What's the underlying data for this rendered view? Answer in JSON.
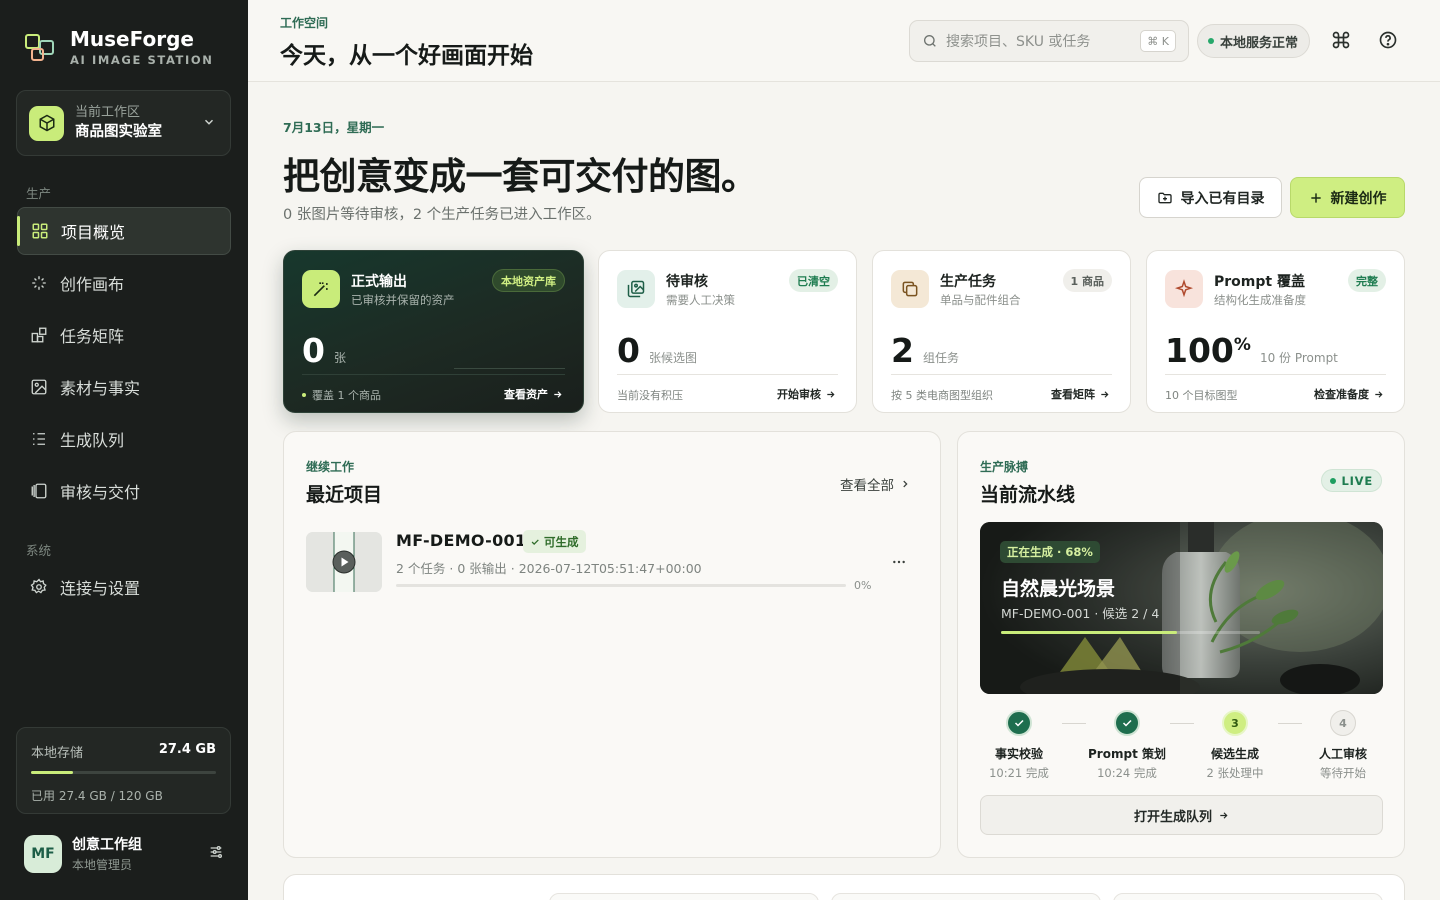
{
  "sidebar": {
    "brand": {
      "name": "MuseForge",
      "subtitle": "AI IMAGE STATION"
    },
    "workspace": {
      "label": "当前工作区",
      "name": "商品图实验室"
    },
    "sections": [
      {
        "title": "生产",
        "items": [
          {
            "label": "项目概览",
            "icon": "grid-icon",
            "active": true
          },
          {
            "label": "创作画布",
            "icon": "sparkle-icon"
          },
          {
            "label": "任务矩阵",
            "icon": "matrix-icon"
          },
          {
            "label": "素材与事实",
            "icon": "image-icon"
          },
          {
            "label": "生成队列",
            "icon": "list-icon"
          },
          {
            "label": "审核与交付",
            "icon": "review-icon"
          }
        ]
      },
      {
        "title": "系统",
        "items": [
          {
            "label": "连接与设置",
            "icon": "gear-icon"
          }
        ]
      }
    ],
    "storage": {
      "label": "本地存储",
      "value": "27.4 GB",
      "detail": "已用 27.4 GB / 120 GB",
      "used_fraction": 0.228
    },
    "user": {
      "initials": "MF",
      "name": "创意工作组",
      "role": "本地管理员"
    }
  },
  "header": {
    "eyebrow": "工作空间",
    "title": "今天，从一个好画面开始",
    "search_placeholder": "搜索项目、SKU 或任务",
    "shortcut": "⌘ K",
    "status": "本地服务正常"
  },
  "hero": {
    "date": "7月13日，星期一",
    "title": "把创意变成一套可交付的图。",
    "subtitle": "0 张图片等待审核，2 个生产任务已进入工作区。",
    "import_label": "导入已有目录",
    "new_label": "新建创作"
  },
  "stats": [
    {
      "title": "正式输出",
      "subtitle": "已审核并保留的资产",
      "badge": "本地资产库",
      "value": "0",
      "unit": "张",
      "footer": "覆盖 1 个商品",
      "link": "查看资产"
    },
    {
      "title": "待审核",
      "subtitle": "需要人工决策",
      "badge": "已清空",
      "value": "0",
      "unit": "张候选图",
      "footer": "当前没有积压",
      "link": "开始审核"
    },
    {
      "title": "生产任务",
      "subtitle": "单品与配件组合",
      "badge": "1 商品",
      "value": "2",
      "unit": "组任务",
      "footer": "按 5 类电商图型组织",
      "link": "查看矩阵"
    },
    {
      "title": "Prompt 覆盖",
      "subtitle": "结构化生成准备度",
      "badge": "完整",
      "value": "100",
      "value_suffix": "%",
      "unit": "10 份 Prompt",
      "footer": "10 个目标图型",
      "link": "检查准备度"
    }
  ],
  "recent": {
    "eyebrow": "继续工作",
    "title": "最近项目",
    "view_all": "查看全部",
    "projects": [
      {
        "name": "MF-DEMO-001",
        "badge": "可生成",
        "meta": "2 个任务 · 0 张输出 · 2026-07-12T05:51:47+00:00",
        "progress": "0%"
      }
    ]
  },
  "pipeline": {
    "eyebrow": "生产脉搏",
    "title": "当前流水线",
    "live": "LIVE",
    "scene": {
      "badge": "正在生成 · 68%",
      "title": "自然晨光场景",
      "meta": "MF-DEMO-001 · 候选 2 / 4",
      "progress": 0.68
    },
    "steps": [
      {
        "name": "事实校验",
        "sub": "10:21 完成",
        "state": "done"
      },
      {
        "name": "Prompt 策划",
        "sub": "10:24 完成",
        "state": "done"
      },
      {
        "name": "候选生成",
        "sub": "2 张处理中",
        "state": "current",
        "num": "3"
      },
      {
        "name": "人工审核",
        "sub": "等待开始",
        "state": "todo",
        "num": "4"
      }
    ],
    "queue_button": "打开生成队列"
  }
}
